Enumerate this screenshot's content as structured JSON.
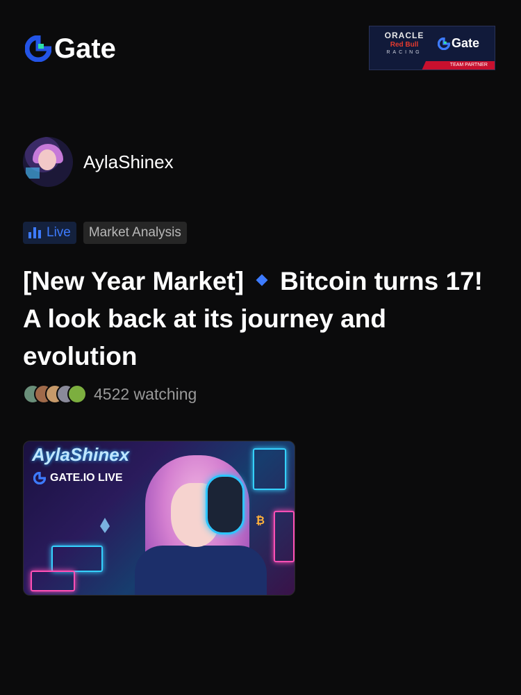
{
  "header": {
    "brand_name": "Gate",
    "partner": {
      "oracle": "ORACLE",
      "redbull": "Red Bull",
      "racing": "RACING",
      "gate": "Gate",
      "team_partner": "TEAM PARTNER"
    }
  },
  "author": {
    "name": "AylaShinex"
  },
  "tags": {
    "live": "Live",
    "category": "Market Analysis"
  },
  "title": {
    "part1": "[New Year Market]",
    "part2": "Bitcoin turns 17! A look back at its journey and evolution"
  },
  "watching": {
    "text": "4522 watching"
  },
  "thumbnail": {
    "overlay_name": "AylaShinex",
    "overlay_live": "GATE.IO LIVE"
  },
  "colors": {
    "accent": "#3d7bff",
    "background": "#0b0b0c",
    "brand_green": "#2fe0a6"
  },
  "icons": [
    "gate-logo-icon",
    "live-bars-icon",
    "diamond-icon"
  ]
}
